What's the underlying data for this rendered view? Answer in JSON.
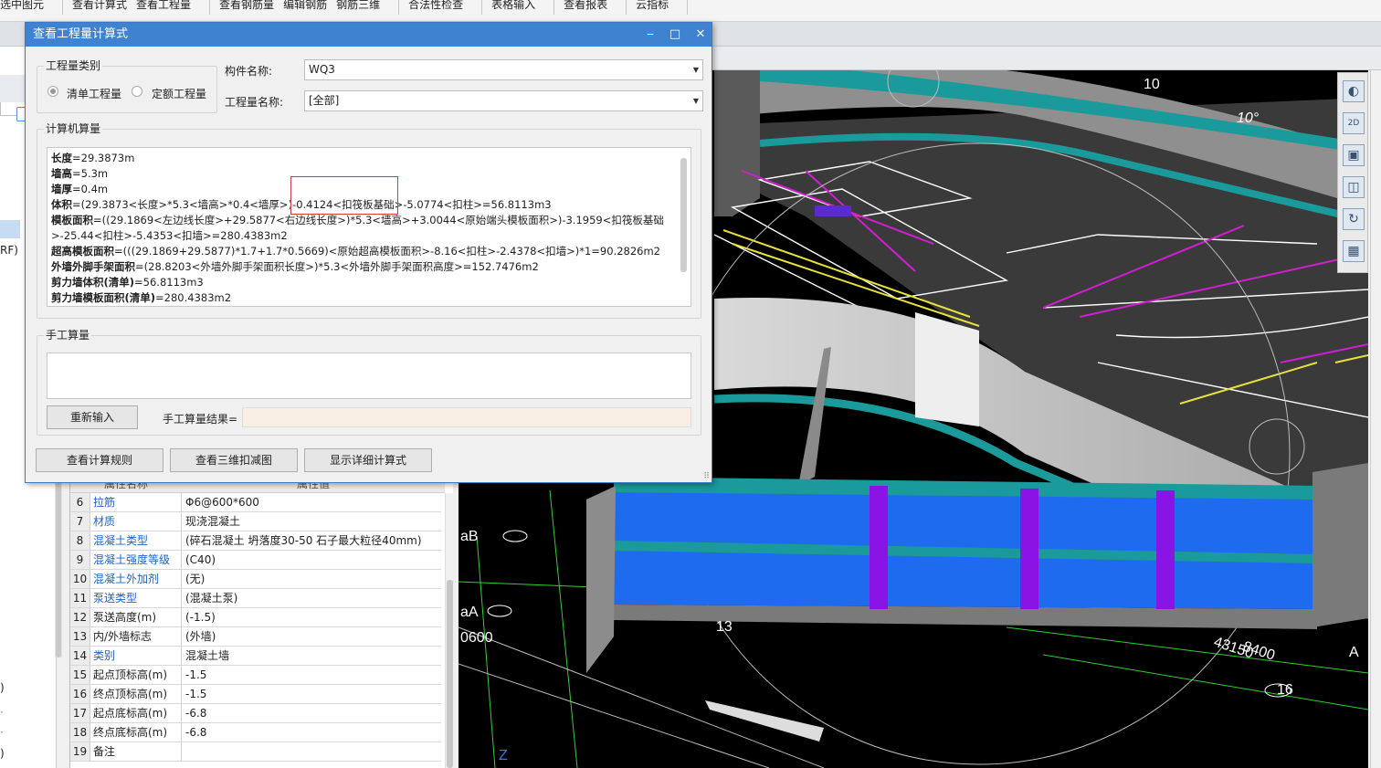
{
  "toolbar": {
    "groups": [
      {
        "items": [
          "选中图元"
        ]
      },
      {
        "items": [
          "查看计算式",
          "查看工程量"
        ]
      },
      {
        "items": [
          "查看钢筋量",
          "编辑钢筋",
          "钢筋三维"
        ]
      },
      {
        "items": [
          "合法性检查"
        ]
      },
      {
        "items": [
          "表格输入"
        ]
      },
      {
        "items": [
          "查看报表"
        ]
      },
      {
        "items": [
          "云指标"
        ]
      }
    ]
  },
  "left_panel": {
    "labels": [
      "RF)",
      ")",
      ")"
    ]
  },
  "dialog": {
    "title": "查看工程量计算式",
    "minimize": "⎯",
    "maximize": "□",
    "close": "✕",
    "category": {
      "legend": "工程量类别",
      "options": [
        "清单工程量",
        "定额工程量"
      ],
      "selected": "清单工程量"
    },
    "component_label": "构件名称:",
    "component_value": "WQ3",
    "quantity_label": "工程量名称:",
    "quantity_value": "[全部]",
    "computed": {
      "legend": "计算机算量",
      "lines": [
        {
          "key": "长度",
          "val": "=29.3873m"
        },
        {
          "key": "墙高",
          "val": "=5.3m"
        },
        {
          "key": "墙厚",
          "val": "=0.4m"
        },
        {
          "key": "体积",
          "val": "=(29.3873<长度>*5.3<墙高>*0.4<墙厚>)-0.4124<扣筏板基础>-5.0774<扣柱>=56.8113m3"
        },
        {
          "key": "模板面积",
          "val": "=((29.1869<左边线长度>+29.5877<右边线长度>)*5.3<墙高>+3.0044<原始端头模板面积>)-3.1959<扣筏板基础>-25.44<扣柱>-5.4353<扣墙>=280.4383m2",
          "wrap": true
        },
        {
          "key": "超高模板面积",
          "val": "=(((29.1869+29.5877)*1.7+1.7*0.5669)<原始超高模板面积>-8.16<扣柱>-2.4378<扣墙>)*1=90.2826m2"
        },
        {
          "key": "外墙外脚手架面积",
          "val": "=(28.8203<外墙外脚手架面积长度>)*5.3<外墙外脚手架面积高度>=152.7476m2"
        },
        {
          "key": "剪力墙体积(清单)",
          "val": "=56.8113m3"
        },
        {
          "key": "剪力墙模板面积(清单)",
          "val": "=280.4383m2"
        }
      ]
    },
    "manual": {
      "legend": "手工算量",
      "reenter": "重新输入",
      "result_label": "手工算量结果=",
      "result_value": ""
    },
    "buttons": {
      "rules": "查看计算规则",
      "view3d": "查看三维扣减图",
      "detail": "显示详细计算式"
    }
  },
  "properties": {
    "header": [
      "属性名称",
      "属性值"
    ],
    "rows": [
      {
        "n": "6",
        "name": "拉筋",
        "value": "Φ6@600*600",
        "blue": true
      },
      {
        "n": "7",
        "name": "材质",
        "value": "现浇混凝土",
        "blue": true
      },
      {
        "n": "8",
        "name": "混凝土类型",
        "value": "(碎石混凝土 坍落度30-50 石子最大粒径40mm)",
        "blue": true
      },
      {
        "n": "9",
        "name": "混凝土强度等级",
        "value": "(C40)",
        "blue": true
      },
      {
        "n": "10",
        "name": "混凝土外加剂",
        "value": "(无)",
        "blue": true
      },
      {
        "n": "11",
        "name": "泵送类型",
        "value": "(混凝土泵)",
        "blue": true
      },
      {
        "n": "12",
        "name": "泵送高度(m)",
        "value": "(-1.5)",
        "blue": false
      },
      {
        "n": "13",
        "name": "内/外墙标志",
        "value": "(外墙)",
        "blue": false
      },
      {
        "n": "14",
        "name": "类别",
        "value": "混凝土墙",
        "blue": true
      },
      {
        "n": "15",
        "name": "起点顶标高(m)",
        "value": "-1.5",
        "blue": false
      },
      {
        "n": "16",
        "name": "终点顶标高(m)",
        "value": "-1.5",
        "blue": false
      },
      {
        "n": "17",
        "name": "起点底标高(m)",
        "value": "-6.8",
        "blue": false
      },
      {
        "n": "18",
        "name": "终点底标高(m)",
        "value": "-6.8",
        "blue": false
      },
      {
        "n": "19",
        "name": "备注",
        "value": "",
        "blue": false
      }
    ]
  },
  "viewport": {
    "labels": {
      "grid10": "10",
      "angle": "10°",
      "gridB": "aB",
      "gridA": "aA",
      "dim0600": "0600",
      "dim13": "13",
      "dim8400": "8400",
      "dim43150": "43150",
      "grid16": "16",
      "gridA2": "A",
      "axisZ": "Z"
    }
  },
  "right_tools": [
    "orbit-icon",
    "2d-view-icon",
    "front-box-icon",
    "iso-box-icon",
    "rotate-icon",
    "grid-view-icon"
  ],
  "colors": {
    "title_bar": "#3f83d0",
    "wall_blue": "#1f6bf0",
    "teal": "#1a9a9a",
    "magenta": "#d21ed2",
    "yellow": "#e8e23c",
    "purple": "#8a14e6"
  }
}
